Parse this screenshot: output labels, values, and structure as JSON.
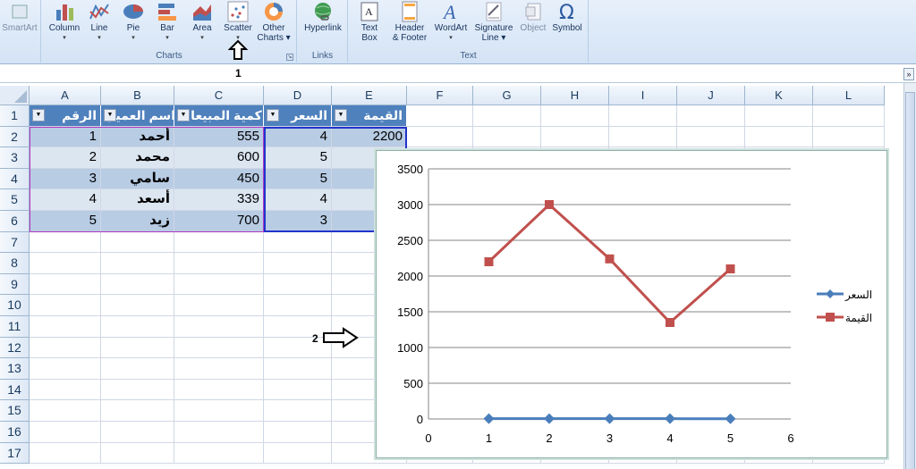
{
  "ribbon": {
    "smartart_label": "SmartArt",
    "charts_group": {
      "label": "Charts",
      "buttons": [
        {
          "label": "Column",
          "caret": "▾"
        },
        {
          "label": "Line",
          "caret": "▾"
        },
        {
          "label": "Pie",
          "caret": "▾"
        },
        {
          "label": "Bar",
          "caret": "▾"
        },
        {
          "label": "Area",
          "caret": "▾"
        },
        {
          "label": "Scatter",
          "caret": "▾"
        },
        {
          "label": "Other",
          "label2": "Charts ▾"
        }
      ]
    },
    "links_group": {
      "label": "Links",
      "hyperlink_label": "Hyperlink"
    },
    "text_group": {
      "label": "Text",
      "buttons": [
        {
          "label": "Text",
          "label2": "Box"
        },
        {
          "label": "Header",
          "label2": "& Footer"
        },
        {
          "label": "WordArt",
          "label2": "▾"
        },
        {
          "label": "Signature",
          "label2": "Line ▾"
        },
        {
          "label": "Object",
          "label2": ""
        },
        {
          "label": "Symbol",
          "label2": ""
        }
      ]
    }
  },
  "annotations": {
    "arrow1_number": "1",
    "arrow2_number": "2"
  },
  "formula_bar": {
    "expand_glyph": "»"
  },
  "sheet": {
    "columns": [
      "A",
      "B",
      "C",
      "D",
      "E",
      "F",
      "G",
      "H",
      "I",
      "J",
      "K",
      "L"
    ],
    "rows": [
      "1",
      "2",
      "3",
      "4",
      "5",
      "6",
      "7",
      "8",
      "9",
      "10",
      "11",
      "12",
      "13",
      "14",
      "15",
      "16",
      "17"
    ],
    "table_headers": [
      "الرقم",
      "اسم العميل",
      "كمية المبيعات",
      "السعر",
      "القيمة"
    ],
    "table_rows": [
      [
        "1",
        "أحمد",
        "555",
        "4",
        "2200"
      ],
      [
        "2",
        "محمد",
        "600",
        "5",
        ""
      ],
      [
        "3",
        "سامي",
        "450",
        "5",
        ""
      ],
      [
        "4",
        "أسعد",
        "339",
        "4",
        ""
      ],
      [
        "5",
        "زيد",
        "700",
        "3",
        ""
      ]
    ],
    "filter_glyph": "▼"
  },
  "chart_data": {
    "type": "line",
    "x": [
      1,
      2,
      3,
      4,
      5
    ],
    "series": [
      {
        "name": "السعر",
        "values": [
          4,
          5,
          5,
          4,
          3
        ],
        "color": "#4a7ebb"
      },
      {
        "name": "القيمة",
        "values": [
          2200,
          3000,
          2240,
          1350,
          2100
        ],
        "color": "#c0504d"
      }
    ],
    "xlim": [
      0,
      6
    ],
    "xticks": [
      "0",
      "1",
      "2",
      "3",
      "4",
      "5",
      "6"
    ],
    "ylim": [
      0,
      3500
    ],
    "yticks": [
      "0",
      "500",
      "1000",
      "1500",
      "2000",
      "2500",
      "3000",
      "3500"
    ],
    "grid": true,
    "legend_position": "right"
  },
  "colors": {
    "header_fill": "#4f81bd",
    "band_dark": "#b8cce4",
    "band_light": "#dce6f1"
  }
}
